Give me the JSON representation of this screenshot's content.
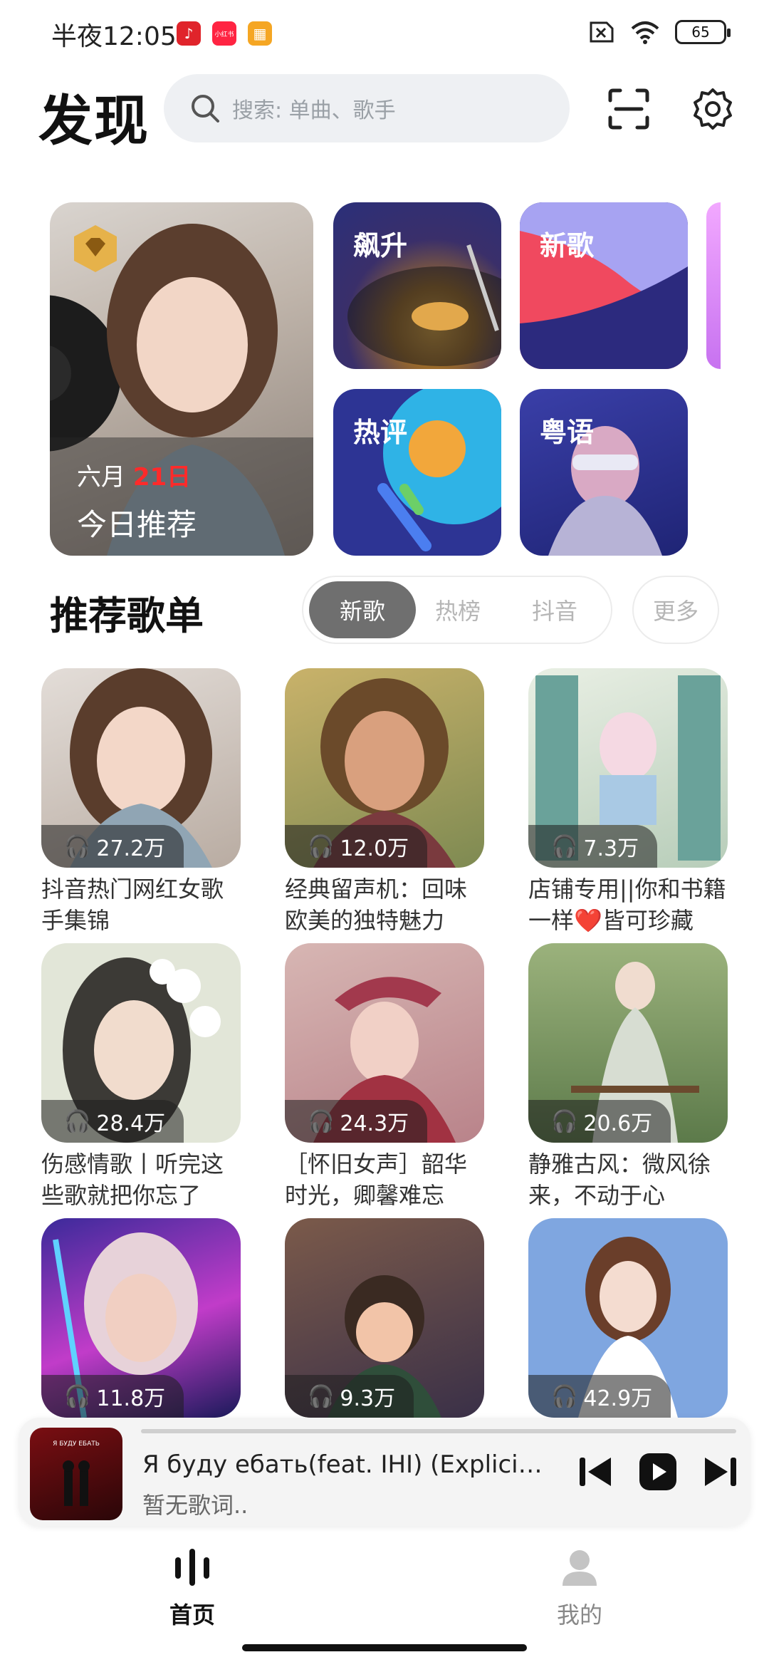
{
  "status_bar": {
    "time": "半夜12:05",
    "notification_apps": [
      {
        "name": "netease-music",
        "color": "#e0242b",
        "glyph": "♪"
      },
      {
        "name": "xiaohongshu",
        "color": "#ff2442",
        "glyph": "小红书"
      },
      {
        "name": "taobao-box",
        "color": "#f5a623",
        "glyph": "▦"
      }
    ],
    "battery": "65"
  },
  "header": {
    "title": "发现",
    "search_placeholder": "搜索: 单曲、歌手"
  },
  "featured": {
    "daily": {
      "month": "六月 ",
      "day": "21日",
      "label": "今日推荐"
    },
    "tiles": [
      {
        "label": "飙升"
      },
      {
        "label": "新歌"
      },
      {
        "label": "热评"
      },
      {
        "label": "粤语"
      }
    ]
  },
  "section": {
    "title": "推荐歌单",
    "tabs": [
      {
        "label": "新歌",
        "active": true
      },
      {
        "label": "热榜",
        "active": false
      },
      {
        "label": "抖音",
        "active": false
      }
    ],
    "more": "更多"
  },
  "playlists": [
    {
      "plays": "27.2万",
      "name": "抖音热门网红女歌手集锦"
    },
    {
      "plays": "12.0万",
      "name": "经典留声机：回味欧美的独特魅力"
    },
    {
      "plays": "7.3万",
      "name": "店铺专用||你和书籍一样❤️皆可珍藏"
    },
    {
      "plays": "28.4万",
      "name": "伤感情歌丨听完这些歌就把你忘了"
    },
    {
      "plays": "24.3万",
      "name": "［怀旧女声］韶华时光，卿馨难忘"
    },
    {
      "plays": "20.6万",
      "name": "静雅古风：微风徐来，不动于心"
    },
    {
      "plays": "11.8万",
      "name": ""
    },
    {
      "plays": "9.3万",
      "name": ""
    },
    {
      "plays": "42.9万",
      "name": ""
    }
  ],
  "player": {
    "song": "Я буду ебать(feat. IHI) (Explicit)...",
    "lyric": "暂无歌词..",
    "art_text": "Я БУДУ ЕБАТЬ"
  },
  "bottom_nav": [
    {
      "label": "首页",
      "active": true
    },
    {
      "label": "我的",
      "active": false
    }
  ]
}
